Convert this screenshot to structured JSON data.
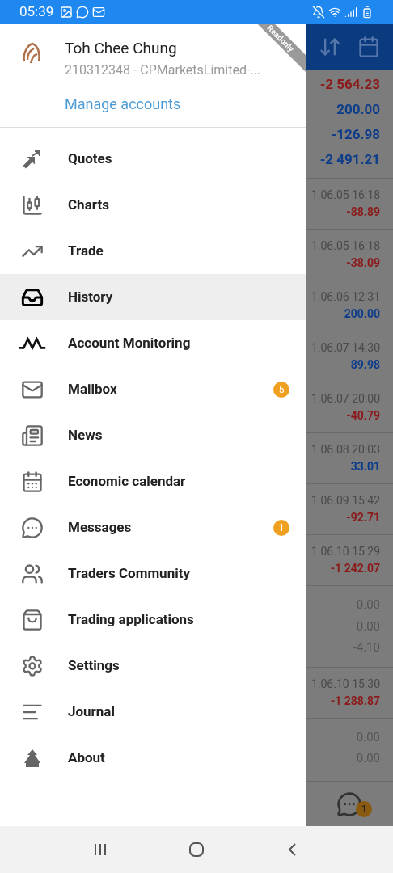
{
  "status_bar": {
    "time": "05:39"
  },
  "account": {
    "name": "Toh Chee Chung",
    "server": "210312348 - CPMarketsLimited-...",
    "manage_link": "Manage accounts",
    "ribbon": "Readonly"
  },
  "menu": [
    {
      "label": "Quotes",
      "selected": false
    },
    {
      "label": "Charts",
      "selected": false
    },
    {
      "label": "Trade",
      "selected": false
    },
    {
      "label": "History",
      "selected": true
    },
    {
      "label": "Account Monitoring",
      "selected": false
    },
    {
      "label": "Mailbox",
      "selected": false,
      "badge": "5"
    },
    {
      "label": "News",
      "selected": false
    },
    {
      "label": "Economic calendar",
      "selected": false
    },
    {
      "label": "Messages",
      "selected": false,
      "badge": "1"
    },
    {
      "label": "Traders Community",
      "selected": false
    },
    {
      "label": "Trading applications",
      "selected": false
    },
    {
      "label": "Settings",
      "selected": false
    },
    {
      "label": "Journal",
      "selected": false
    },
    {
      "label": "About",
      "selected": false
    }
  ],
  "background": {
    "summary": [
      {
        "value": "-2 564.23",
        "color": "#8b1a1a"
      },
      {
        "value": "200.00",
        "color": "#0d3c8a"
      },
      {
        "value": "-126.98",
        "color": "#0d3c8a"
      },
      {
        "value": "-2 491.21",
        "color": "#0d3c8a"
      }
    ],
    "rows": [
      {
        "kind": "deal",
        "time": "1.06.05 16:18",
        "value": "-88.89",
        "color": "#8b1a1a"
      },
      {
        "kind": "deal",
        "time": "1.06.05 16:18",
        "value": "-38.09",
        "color": "#8b1a1a"
      },
      {
        "kind": "deal",
        "time": "1.06.06 12:31",
        "value": "200.00",
        "color": "#0d3c8a"
      },
      {
        "kind": "deal",
        "time": "1.06.07 14:30",
        "value": "89.98",
        "color": "#0d3c8a"
      },
      {
        "kind": "deal",
        "time": "1.06.07 20:00",
        "value": "-40.79",
        "color": "#8b1a1a"
      },
      {
        "kind": "deal",
        "time": "1.06.08 20:03",
        "value": "33.01",
        "color": "#0d3c8a"
      },
      {
        "kind": "deal",
        "time": "1.06.09 15:42",
        "value": "-92.71",
        "color": "#8b1a1a"
      },
      {
        "kind": "deal",
        "time": "1.06.10 15:29",
        "value": "-1 242.07",
        "color": "#8b1a1a"
      },
      {
        "kind": "totals",
        "values": [
          "0.00",
          "0.00",
          "-4.10"
        ]
      },
      {
        "kind": "deal",
        "time": "1.06.10 15:30",
        "value": "-1 288.87",
        "color": "#8b1a1a"
      },
      {
        "kind": "totals",
        "values": [
          "0.00",
          "0.00"
        ]
      }
    ],
    "chat_badge": "1"
  }
}
